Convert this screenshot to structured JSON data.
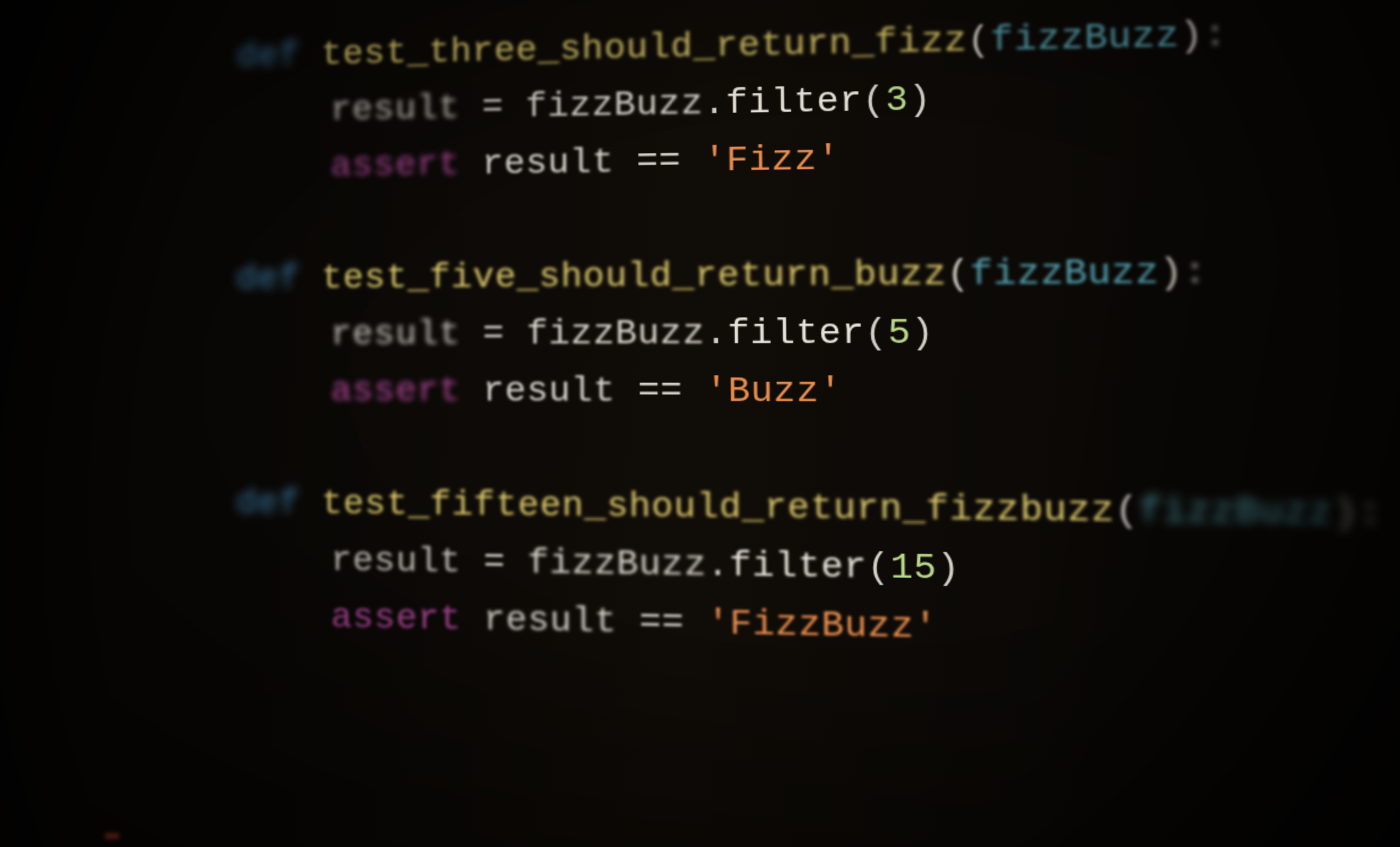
{
  "colors": {
    "background": "#0a0806",
    "keyword_def": "#4a9fd8",
    "keyword_assert": "#c74fb0",
    "function_name": "#d9c668",
    "identifier": "#d4cfc7",
    "parameter": "#5fb8c9",
    "number": "#b8d98a",
    "string": "#e88b4a"
  },
  "code": {
    "functions": [
      {
        "def_kw": "def",
        "name": "test_three_should_return_fizz",
        "param": "fizzBuzz",
        "body_result_var": "result",
        "body_assign_op": "=",
        "body_obj": "fizzBuzz",
        "body_method": "filter",
        "body_arg": "3",
        "assert_kw": "assert",
        "assert_var": "result",
        "assert_op": "==",
        "assert_val": "'Fizz'"
      },
      {
        "def_kw": "def",
        "name": "test_five_should_return_buzz",
        "param": "fizzBuzz",
        "body_result_var": "result",
        "body_assign_op": "=",
        "body_obj": "fizzBuzz",
        "body_method": "filter",
        "body_arg": "5",
        "assert_kw": "assert",
        "assert_var": "result",
        "assert_op": "==",
        "assert_val": "'Buzz'"
      },
      {
        "def_kw": "def",
        "name": "test_fifteen_should_return_fizzbuzz",
        "param": "fizzBuzz",
        "body_result_var": "result",
        "body_assign_op": "=",
        "body_obj": "fizzBuzz",
        "body_method": "filter",
        "body_arg": "15",
        "assert_kw": "assert",
        "assert_var": "result",
        "assert_op": "==",
        "assert_val": "'FizzBuzz'"
      }
    ]
  }
}
